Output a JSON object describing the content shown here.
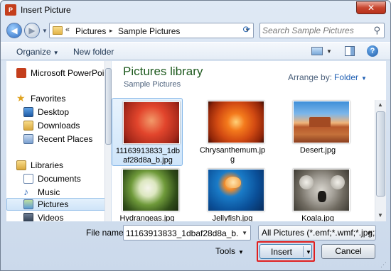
{
  "window": {
    "title": "Insert Picture",
    "app_icon_text": "P",
    "close_label": "✕"
  },
  "address": {
    "path_prefix": "«",
    "segments": [
      "Pictures",
      "Sample Pictures"
    ],
    "separator": "▸",
    "search_placeholder": "Search Sample Pictures"
  },
  "toolbar": {
    "organize_label": "Organize",
    "new_folder_label": "New folder",
    "help_label": "?"
  },
  "nav": {
    "items": [
      {
        "label": "Microsoft PowerPoin",
        "icon": "powerpoint-icon"
      },
      {
        "label": "Favorites",
        "icon": "star-icon"
      },
      {
        "label": "Desktop",
        "icon": "desktop-icon"
      },
      {
        "label": "Downloads",
        "icon": "downloads-icon"
      },
      {
        "label": "Recent Places",
        "icon": "recent-places-icon"
      },
      {
        "label": "Libraries",
        "icon": "libraries-icon"
      },
      {
        "label": "Documents",
        "icon": "documents-icon"
      },
      {
        "label": "Music",
        "icon": "music-icon"
      },
      {
        "label": "Pictures",
        "icon": "pictures-icon",
        "selected": true
      },
      {
        "label": "Videos",
        "icon": "videos-icon"
      }
    ]
  },
  "library": {
    "title": "Pictures library",
    "subtitle": "Sample Pictures",
    "arrange_label": "Arrange by:",
    "arrange_value": "Folder",
    "files": [
      {
        "name": "11163913833_1dbaf28d8a_b.jpg",
        "selected": true
      },
      {
        "name": "Chrysanthemum.jpg"
      },
      {
        "name": "Desert.jpg"
      },
      {
        "name": "Hydrangeas.jpg"
      },
      {
        "name": "Jellyfish.jpg"
      },
      {
        "name": "Koala.jpg"
      }
    ]
  },
  "footer": {
    "filename_label": "File name:",
    "filename_value": "11163913833_1dbaf28d8a_b.jpg",
    "filter_value": "All Pictures (*.emf;*.wmf;*.jpg;*",
    "tools_label": "Tools",
    "insert_label": "Insert",
    "cancel_label": "Cancel"
  },
  "colors": {
    "highlight": "#e01f1f",
    "library_title": "#1e5a1e",
    "link_blue": "#1f5fb3"
  }
}
